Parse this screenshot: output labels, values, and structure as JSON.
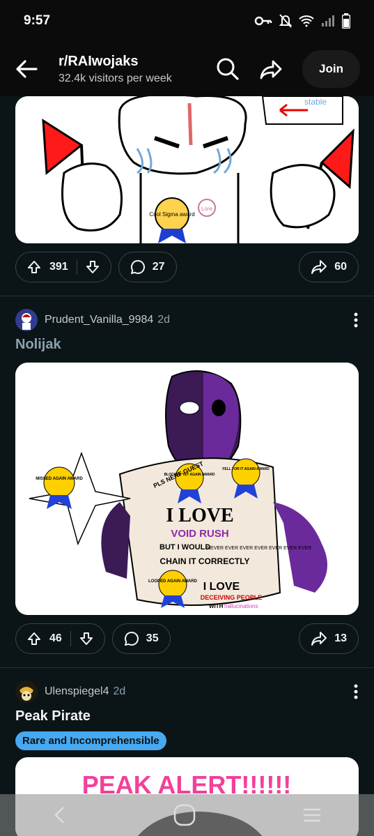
{
  "status": {
    "time": "9:57"
  },
  "header": {
    "title": "r/RAIwojaks",
    "subtitle": "32.4k visitors per week",
    "join_label": "Join"
  },
  "posts": [
    {
      "media_labels": {
        "badge": "Cool Sigma award",
        "pin": "Lore",
        "sign": "stable"
      },
      "upvotes": "391",
      "comments": "27",
      "shares": "60"
    },
    {
      "author": "Prudent_Vanilla_9984",
      "age": "2d",
      "title": "Nolijak",
      "media_labels": {
        "award_left": "MISSED AGAIN AWARD",
        "award_mid": "BLOCKED YET AGAIN AWARD",
        "award_right": "FELL FOR IT AGAIN AWARD",
        "award_bottom": "LOOPED AGAIN AWARD",
        "nerf": "PLS NERF GUEST",
        "line1": "I LOVE",
        "line2": "VOID RUSH",
        "line3a": "BUT I WOULD",
        "line3b": "NEVER EVER EVER EVER EVER EVER EVER",
        "line4": "CHAIN IT CORRECTLY",
        "line5": "I LOVE",
        "line6": "DECEIVING PEOPLE",
        "line7a": "WITH",
        "line7b": "hallucinations"
      },
      "upvotes": "46",
      "comments": "35",
      "shares": "13"
    },
    {
      "author": "Ulenspiegel4",
      "age": "2d",
      "title": "Peak Pirate",
      "flair": "Rare and Incomprehensible",
      "media_labels": {
        "headline": "PEAK ALERT!!!!!!"
      }
    }
  ]
}
